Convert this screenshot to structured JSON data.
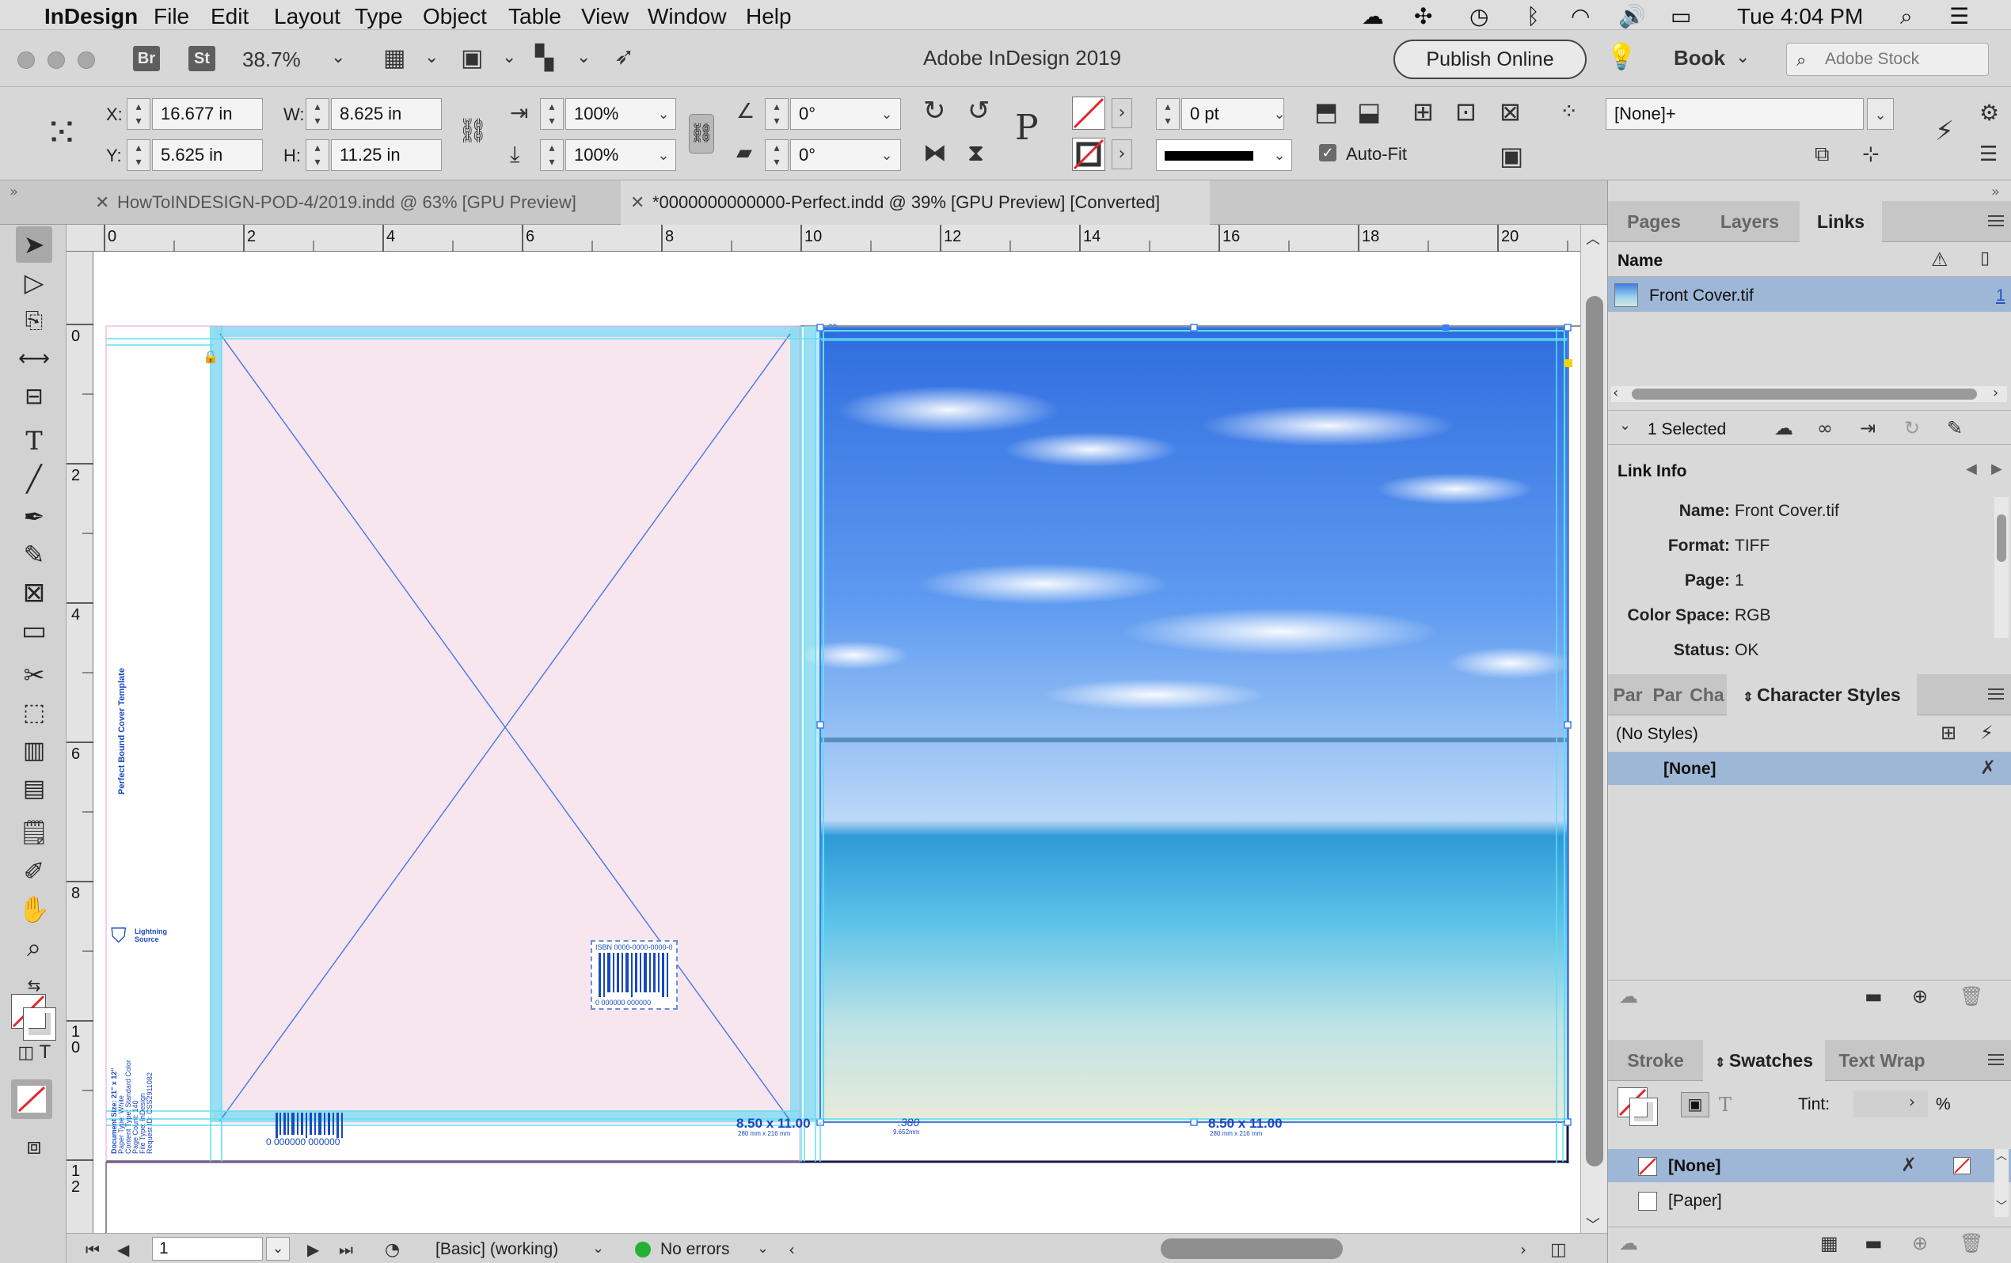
{
  "menubar": {
    "app": "InDesign",
    "items": [
      "File",
      "Edit",
      "Layout",
      "Type",
      "Object",
      "Table",
      "View",
      "Window",
      "Help"
    ],
    "clock": "Tue 4:04 PM"
  },
  "appbar": {
    "bridge": "Br",
    "stock": "St",
    "zoom": "38.7%",
    "title": "Adobe InDesign 2019",
    "publish": "Publish Online",
    "workspace": "Book",
    "search_placeholder": "Adobe Stock"
  },
  "control": {
    "x_label": "X:",
    "x": "16.677 in",
    "y_label": "Y:",
    "y": "5.625 in",
    "w_label": "W:",
    "w": "8.625 in",
    "h_label": "H:",
    "h": "11.25 in",
    "scale_x": "100%",
    "scale_y": "100%",
    "rotate": "0°",
    "shear": "0°",
    "stroke_weight": "0 pt",
    "autofit": "Auto-Fit",
    "object_style": "[None]+"
  },
  "doc_tabs": [
    {
      "label": "HowToINDESIGN-POD-4/2019.indd @ 63% [GPU Preview]"
    },
    {
      "label": "*0000000000000-Perfect.indd @ 39% [GPU Preview] [Converted]"
    }
  ],
  "rulers": {
    "h": [
      "0",
      "2",
      "4",
      "6",
      "8",
      "10",
      "12",
      "14",
      "16",
      "18",
      "20"
    ],
    "v": [
      "0",
      "2",
      "4",
      "6",
      "8",
      "1\n0",
      "1\n2"
    ]
  },
  "spread": {
    "spine_title": "Perfect Bound Cover Template",
    "publisher_logo": "Lightning Source",
    "isbn": "ISBN 0000-0000-0000-0",
    "barcode_digits": "0 000000 000000",
    "trim_left": "8.50 x 11.00",
    "trim_left_mm": "280 mm x 216 mm",
    "trim_right": "8.50 x 11.00",
    "trim_right_mm": "280 mm x 216 mm",
    "spine_width": ".380",
    "spine_width_mm": "9.652mm",
    "doc_info": [
      "Document Size: 21\" x 12\"",
      "Paper Type: White",
      "Content Type: Standard Color",
      "Page Count: 140",
      "File Type: InDesign",
      "Request ID: CSS2911082"
    ]
  },
  "status": {
    "page": "1",
    "preflight_profile": "[Basic] (working)",
    "errors": "No errors"
  },
  "links_panel": {
    "tabs": [
      "Pages",
      "Layers",
      "Links"
    ],
    "col_name": "Name",
    "items": [
      {
        "name": "Front Cover.tif",
        "page": "1"
      }
    ],
    "selected": "1 Selected",
    "info_title": "Link Info",
    "info": [
      {
        "k": "Name:",
        "v": "Front Cover.tif"
      },
      {
        "k": "Format:",
        "v": "TIFF"
      },
      {
        "k": "Page:",
        "v": "1"
      },
      {
        "k": "Color Space:",
        "v": "RGB"
      },
      {
        "k": "Status:",
        "v": "OK"
      }
    ]
  },
  "styles_panel": {
    "tabs": [
      "Par",
      "Par",
      "Cha",
      "Character Styles"
    ],
    "no_styles": "(No Styles)",
    "items": [
      "[None]"
    ]
  },
  "swatches_panel": {
    "tabs": [
      "Stroke",
      "Swatches",
      "Text Wrap"
    ],
    "tint_label": "Tint:",
    "tint_unit": "%",
    "items": [
      "[None]",
      "[Paper]"
    ]
  },
  "colors": {
    "bleed_blue": "#8fdcf2",
    "guide_cyan": "#5ee0f0",
    "back_cover_pink": "#f8e6ee",
    "selection_blue": "#9fb7d6",
    "frame_blue": "#3d7ff0"
  }
}
